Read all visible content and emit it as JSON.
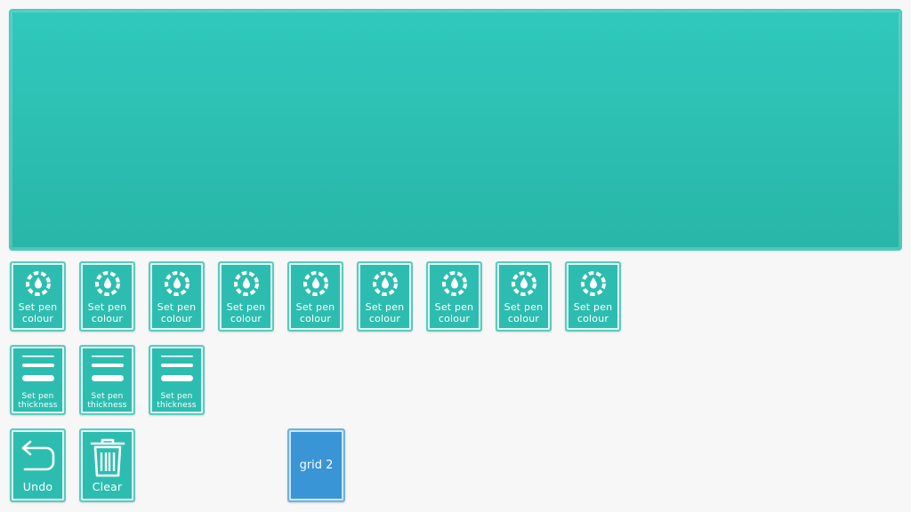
{
  "canvas": {
    "color": "#2dc4b7"
  },
  "colour_buttons": [
    {
      "line1": "Set pen",
      "line2": "colour",
      "icon": "palette-drop-icon"
    },
    {
      "line1": "Set pen",
      "line2": "colour",
      "icon": "palette-drop-icon"
    },
    {
      "line1": "Set pen",
      "line2": "colour",
      "icon": "palette-drop-icon"
    },
    {
      "line1": "Set pen",
      "line2": "colour",
      "icon": "palette-drop-icon"
    },
    {
      "line1": "Set pen",
      "line2": "colour",
      "icon": "palette-drop-icon"
    },
    {
      "line1": "Set pen",
      "line2": "colour",
      "icon": "palette-drop-icon"
    },
    {
      "line1": "Set pen",
      "line2": "colour",
      "icon": "palette-drop-icon"
    },
    {
      "line1": "Set pen",
      "line2": "colour",
      "icon": "palette-drop-icon"
    },
    {
      "line1": "Set pen",
      "line2": "colour",
      "icon": "palette-drop-icon"
    }
  ],
  "thickness_buttons": [
    {
      "line1": "Set pen",
      "line2": "thickness",
      "icon": "line-thickness-icon"
    },
    {
      "line1": "Set pen",
      "line2": "thickness",
      "icon": "line-thickness-icon"
    },
    {
      "line1": "Set pen",
      "line2": "thickness",
      "icon": "line-thickness-icon"
    }
  ],
  "actions": {
    "undo": {
      "label": "Undo",
      "icon": "undo-arrow-icon"
    },
    "clear": {
      "label": "Clear",
      "icon": "trash-icon"
    }
  },
  "grid_button": {
    "label": "grid 2",
    "color": "#3a95d6"
  },
  "colors": {
    "accent": "#2dbdb0",
    "tile_border": "#55cdbf",
    "background": "#f7f7f7"
  }
}
